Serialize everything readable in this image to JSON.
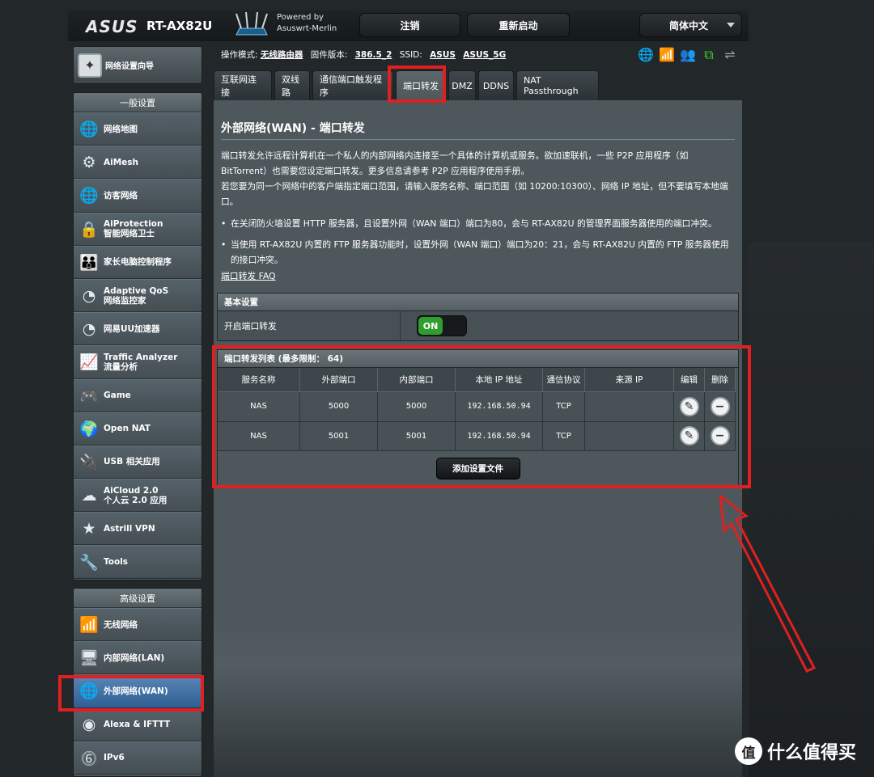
{
  "header": {
    "brand": "ASUS",
    "model": "RT-AX82U",
    "powered_line1": "Powered by",
    "powered_line2": "Asuswrt-Merlin",
    "logout": "注销",
    "reboot": "重新启动",
    "language": "简体中文"
  },
  "sidebar": {
    "qis": "网络设置向导",
    "general_header": "一般设置",
    "general_items": [
      {
        "l1": "网络地图",
        "l2": "",
        "icon": "globe-icon"
      },
      {
        "l1": "AiMesh",
        "l2": "",
        "icon": "mesh-icon"
      },
      {
        "l1": "访客网络",
        "l2": "",
        "icon": "globe-icon"
      },
      {
        "l1": "AiProtection",
        "l2": "智能网络卫士",
        "icon": "lock-icon"
      },
      {
        "l1": "家长电脑控制程序",
        "l2": "",
        "icon": "family-icon"
      },
      {
        "l1": "Adaptive QoS",
        "l2": "网络监控家",
        "icon": "gauge-icon"
      },
      {
        "l1": "网易UU加速器",
        "l2": "",
        "icon": "gauge-icon"
      },
      {
        "l1": "Traffic Analyzer",
        "l2": "流量分析",
        "icon": "chart-icon"
      },
      {
        "l1": "Game",
        "l2": "",
        "icon": "gamepad-icon"
      },
      {
        "l1": "Open NAT",
        "l2": "",
        "icon": "globe-gear-icon"
      },
      {
        "l1": "USB 相关应用",
        "l2": "",
        "icon": "usb-icon"
      },
      {
        "l1": "AiCloud 2.0",
        "l2": "个人云 2.0 应用",
        "icon": "cloud-icon"
      },
      {
        "l1": "Astrill VPN",
        "l2": "",
        "icon": "star-icon"
      },
      {
        "l1": "Tools",
        "l2": "",
        "icon": "wrench-icon"
      }
    ],
    "advanced_header": "高级设置",
    "advanced_items": [
      {
        "l1": "无线网络",
        "l2": "",
        "icon": "wifi-icon"
      },
      {
        "l1": "内部网络(LAN)",
        "l2": "",
        "icon": "monitor-icon"
      },
      {
        "l1": "外部网络(WAN)",
        "l2": "",
        "icon": "globe-icon"
      },
      {
        "l1": "Alexa & IFTTT",
        "l2": "",
        "icon": "voice-icon"
      },
      {
        "l1": "IPv6",
        "l2": "",
        "icon": "ipv6-icon"
      }
    ]
  },
  "status": {
    "mode_label": "操作模式:",
    "mode_value": "无线路由器",
    "fw_label": "固件版本:",
    "fw_value": "386.5_2",
    "ssid_label": "SSID:",
    "ssid1": "ASUS",
    "ssid2": "ASUS_5G"
  },
  "tabs": [
    "互联网连接",
    "双线路",
    "通信端口触发程序",
    "端口转发",
    "DMZ",
    "DDNS",
    "NAT Passthrough"
  ],
  "main": {
    "title": "外部网络(WAN) - 端口转发",
    "desc1": "端口转发允许远程计算机在一个私人的内部网络内连接至一个具体的计算机或服务。欲加速联机，一些 P2P 应用程序（如 BitTorrent）也需要您设定端口转发。更多信息请参考 P2P 应用程序使用手册。",
    "desc2": "若您要为同一个网络中的客户端指定端口范围，请输入服务名称、端口范围（如 10200:10300）、网络 IP 地址，但不要填写本地端口。",
    "bullet1": "在关闭防火墙设置 HTTP 服务器，且设置外网（WAN 端口）端口为80，会与 RT-AX82U 的管理界面服务器使用的端口冲突。",
    "bullet2": "当使用 RT-AX82U 内置的 FTP 服务器功能时，设置外网（WAN 端口）端口为20：21，会与 RT-AX82U 内置的 FTP 服务器使用的接口冲突。",
    "faq": "端口转发 FAQ",
    "basic_header": "基本设置",
    "enable_label": "开启端口转发",
    "toggle_on": "ON",
    "list_header": "端口转发列表 (最多限制： 64)",
    "columns": [
      "服务名称",
      "外部端口",
      "内部端口",
      "本地 IP 地址",
      "通信协议",
      "来源 IP",
      "编辑",
      "删除"
    ],
    "rows": [
      {
        "name": "NAS",
        "ext": "5000",
        "int": "5000",
        "ip": "192.168.50.94",
        "proto": "TCP",
        "src": ""
      },
      {
        "name": "NAS",
        "ext": "5001",
        "int": "5001",
        "ip": "192.168.50.94",
        "proto": "TCP",
        "src": ""
      }
    ],
    "add_button": "添加设置文件"
  },
  "watermark": {
    "logo": "值",
    "text": "什么值得买"
  },
  "colors": {
    "accent_red": "#e02020",
    "toggle_green": "#2f9e2c",
    "active_menu": "#3a6ea5"
  }
}
